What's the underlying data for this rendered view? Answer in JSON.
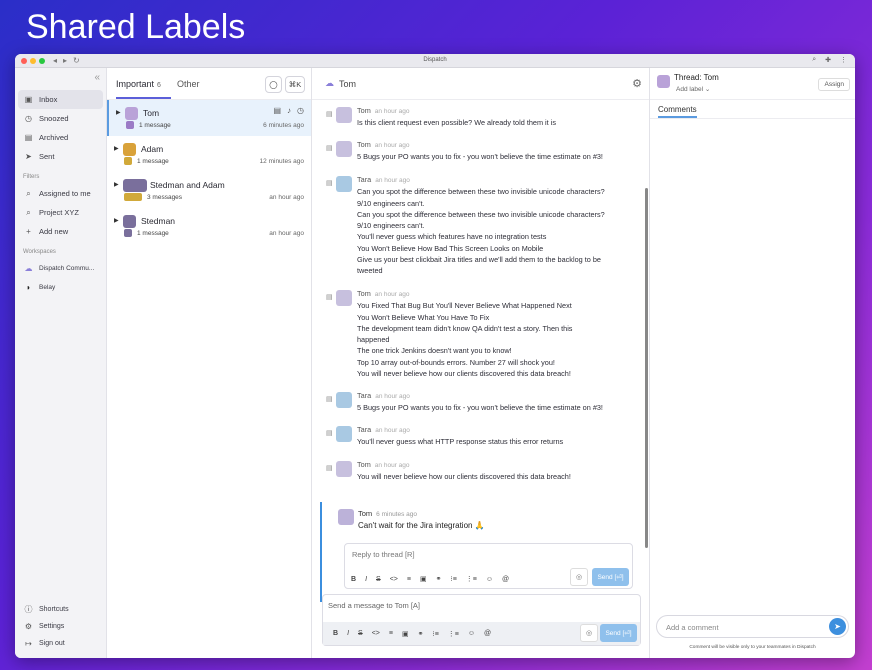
{
  "headline": "Shared Labels",
  "window": {
    "title": "Dispatch",
    "nav_back": "◂",
    "nav_fwd": "▸",
    "nav_reload": "↻",
    "right_icons": [
      "⌕",
      "✚",
      "⋮"
    ]
  },
  "sidebar": {
    "collapse_icon": "«",
    "items": [
      {
        "label": "Inbox",
        "icon": "▣"
      },
      {
        "label": "Snoozed",
        "icon": "◷"
      },
      {
        "label": "Archived",
        "icon": "▤"
      },
      {
        "label": "Sent",
        "icon": "➤"
      }
    ],
    "filters_label": "Filters",
    "filters": [
      {
        "label": "Assigned to me",
        "icon": "⌕"
      },
      {
        "label": "Project XYZ",
        "icon": "⌕"
      },
      {
        "label": "Add new",
        "icon": "+"
      }
    ],
    "workspaces_label": "Workspaces",
    "workspaces": [
      {
        "label": "Dispatch Commu...",
        "icon": "☁"
      },
      {
        "label": "Belay",
        "icon": "◗"
      }
    ],
    "bottom": [
      {
        "label": "Shortcuts",
        "icon": "ⓘ"
      },
      {
        "label": "Settings",
        "icon": "⚙"
      },
      {
        "label": "Sign out",
        "icon": "↦"
      }
    ]
  },
  "list": {
    "tab_important": "Important",
    "tab_important_count": "6",
    "tab_other": "Other",
    "btn_compose": "◯",
    "btn_cmdk": "⌘K",
    "threads": [
      {
        "name": "Tom",
        "sub": "1 message",
        "time": "6 minutes ago"
      },
      {
        "name": "Adam",
        "sub": "1 message",
        "time": "12 minutes ago"
      },
      {
        "name": "Stedman and Adam",
        "sub": "3 messages",
        "time": "an hour ago"
      },
      {
        "name": "Stedman",
        "sub": "1 message",
        "time": "an hour ago"
      }
    ]
  },
  "main": {
    "channel": "Tom",
    "channel_icon": "☁",
    "messages": [
      {
        "author": "Tom",
        "time": "an hour ago",
        "lines": [
          "Is this client request even possible? We already told them it is"
        ]
      },
      {
        "author": "Tom",
        "time": "an hour ago",
        "lines": [
          "5 Bugs your PO wants you to fix - you won't believe the time estimate on #3!"
        ]
      },
      {
        "author": "Tara",
        "time": "an hour ago",
        "lines": [
          "Can you spot the difference between these two invisible unicode characters?",
          "9/10 engineers can't.",
          "Can you spot the difference between these two invisible unicode characters?",
          "9/10 engineers can't.",
          "You'll never guess which features have no integration tests",
          "You Won't Believe How Bad This Screen Looks on Mobile",
          "Give us your best clickbait Jira titles and we'll add them to the backlog to be",
          "tweeted"
        ]
      },
      {
        "author": "Tom",
        "time": "an hour ago",
        "lines": [
          "You Fixed That Bug But You'll Never Believe What Happened Next",
          "You Won't Believe What You Have To Fix",
          "The development team didn't know QA didn't test a story. Then this",
          "happened",
          "The one trick Jenkins doesn't want you to know!",
          "Top 10 array out-of-bounds errors. Number 27 will shock you!",
          "You will never believe how our clients discovered this data breach!"
        ]
      },
      {
        "author": "Tara",
        "time": "an hour ago",
        "lines": [
          "5 Bugs your PO wants you to fix - you won't believe the time estimate on #3!"
        ]
      },
      {
        "author": "Tara",
        "time": "an hour ago",
        "lines": [
          "You'll never guess what HTTP response status this error returns"
        ]
      },
      {
        "author": "Tom",
        "time": "an hour ago",
        "lines": [
          "You will never believe how our clients discovered this data breach!"
        ]
      }
    ],
    "focused": {
      "author": "Tom",
      "time": "6 minutes ago",
      "text": "Can't wait for the Jira integration 🙏"
    },
    "reply_placeholder": "Reply to thread [R]",
    "composer_placeholder": "Send a message to Tom [A]",
    "send_label": "Send [⏎]",
    "format_icons": [
      "B",
      "I",
      "S",
      "<>",
      "≡",
      "▣",
      "⚭",
      "⁝≡",
      "⋮≡",
      "☺",
      "@"
    ],
    "attach_icon": "◎"
  },
  "right": {
    "title": "Thread: Tom",
    "add_label": "Add label ⌄",
    "assign": "Assign",
    "tab": "Comments",
    "comment_placeholder": "Add a comment",
    "note": "Comment will be visible only to your teammates in Dispatch",
    "send_icon": "➤"
  },
  "colors": {
    "accent": "#5b5fd9",
    "selected_row": "#e8f2fc",
    "send_button": "#8fc0ec",
    "comment_send": "#3d8fde"
  }
}
